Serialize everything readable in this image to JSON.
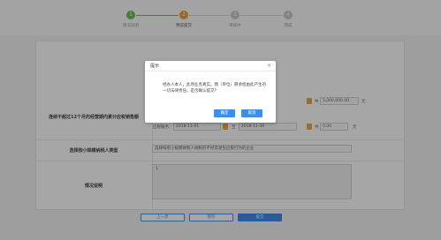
{
  "steps": [
    {
      "label": "情况说明",
      "state": "done",
      "num": "1"
    },
    {
      "label": "预览提交",
      "state": "active",
      "num": "2"
    },
    {
      "label": "审核中",
      "state": "todo",
      "num": "3"
    },
    {
      "label": "完成",
      "state": "todo",
      "num": "4"
    }
  ],
  "form": {
    "row1": {
      "label": "连续不超过12个月的经营期内累计应税销售额",
      "amount_prefix": "共",
      "amount": "5,000,000.00",
      "amount_unit": "元",
      "period_label": "应税服务：",
      "period_start": "2018-11-01",
      "period_to": "至",
      "period_end": "2018-11-30",
      "amount2_prefix": "共",
      "amount2": "0.00",
      "amount2_unit": "元"
    },
    "row2": {
      "label": "选择按小规模纳税人类型",
      "value": "选择按照小规模纳税人纳税的不经常发生应税行为的企业"
    },
    "row3": {
      "label": "情况说明",
      "value": "1"
    }
  },
  "buttons": {
    "prev": "上一步",
    "save": "暂存",
    "submit": "提交"
  },
  "dialog": {
    "title": "提示",
    "message": "经办人本人，此项业务真实。我（单位）愿承担由此产生的一切法律责任。是否确认提交？",
    "confirm": "确定",
    "cancel": "取消"
  },
  "colors": {
    "done": "#6bbf59",
    "active": "#e6a23c",
    "todo": "#c9c9c9",
    "primary": "#3d8ee6"
  }
}
